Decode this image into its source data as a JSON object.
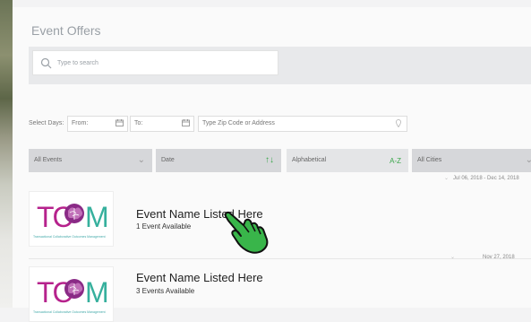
{
  "page": {
    "title": "Event Offers"
  },
  "search": {
    "placeholder": "Type to search"
  },
  "dates": {
    "select_label": "Select Days:",
    "from_label": "From:",
    "to_label": "To:",
    "zip_placeholder": "Type Zip Code or Address"
  },
  "filters": {
    "all_events": "All Events",
    "date": "Date",
    "date_sort_icon": "↑↓",
    "alphabetical": "Alphabetical",
    "az": "A-Z",
    "all_cities": "All Cities"
  },
  "events": [
    {
      "range": "Jul 06, 2018 - Dec 14, 2018",
      "name": "Event Name Listed Here",
      "count": "1 Event Available",
      "logo_text_left": "TC",
      "logo_text_right": "M",
      "logo_sub": "Transactional Collaborative Outcomes Management"
    },
    {
      "range": "Nov 27, 2018",
      "name": "Event Name Listed Here",
      "count": "3 Events Available",
      "logo_text_left": "TC",
      "logo_text_right": "M",
      "logo_sub": "Transactional Collaborative Outcomes Management"
    }
  ],
  "colors": {
    "accent_green": "#3aa64a",
    "tcom_magenta": "#b6228c",
    "tcom_teal": "#36b09d"
  }
}
